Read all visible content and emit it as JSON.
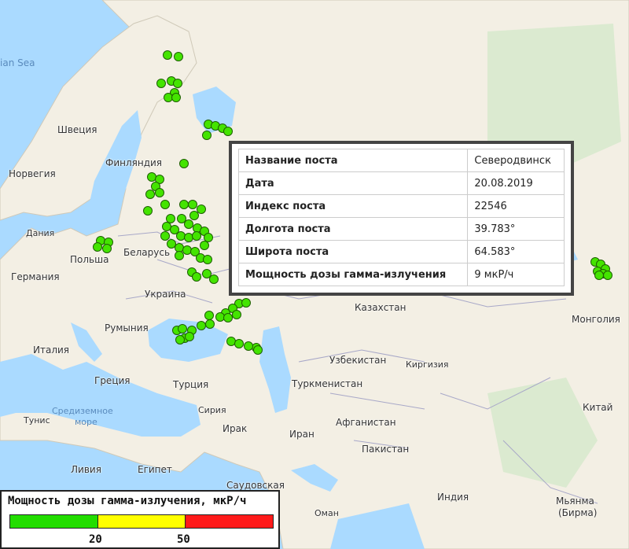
{
  "map": {
    "labels": [
      {
        "text": "ian Sea",
        "type": "sea"
      },
      {
        "text": "Швеция",
        "type": "country"
      },
      {
        "text": "Финляндия",
        "type": "country"
      },
      {
        "text": "Норвегия",
        "type": "country"
      },
      {
        "text": "Дания",
        "type": "country"
      },
      {
        "text": "Беларусь",
        "type": "country"
      },
      {
        "text": "Польша",
        "type": "country"
      },
      {
        "text": "Германия",
        "type": "country"
      },
      {
        "text": "Украина",
        "type": "country"
      },
      {
        "text": "Румыния",
        "type": "country"
      },
      {
        "text": "Италия",
        "type": "country"
      },
      {
        "text": "Греция",
        "type": "country"
      },
      {
        "text": "Турция",
        "type": "country"
      },
      {
        "text": "Средиземное",
        "type": "sea"
      },
      {
        "text": "море",
        "type": "sea"
      },
      {
        "text": "Тунис",
        "type": "country"
      },
      {
        "text": "Сирия",
        "type": "country"
      },
      {
        "text": "Ирак",
        "type": "country"
      },
      {
        "text": "Иран",
        "type": "country"
      },
      {
        "text": "Ливия",
        "type": "country"
      },
      {
        "text": "Египет",
        "type": "country"
      },
      {
        "text": "Саудовская",
        "type": "country"
      },
      {
        "text": "Казахстан",
        "type": "country"
      },
      {
        "text": "Узбекистан",
        "type": "country"
      },
      {
        "text": "Киргизия",
        "type": "country"
      },
      {
        "text": "Туркменистан",
        "type": "country"
      },
      {
        "text": "Афганистан",
        "type": "country"
      },
      {
        "text": "Пакистан",
        "type": "country"
      },
      {
        "text": "Индия",
        "type": "country"
      },
      {
        "text": "Монголия",
        "type": "country"
      },
      {
        "text": "Китай",
        "type": "country"
      },
      {
        "text": "Мьянма",
        "type": "country"
      },
      {
        "text": "(Бирма)",
        "type": "country"
      },
      {
        "text": "Оман",
        "type": "country"
      }
    ],
    "marker_color": "#44e400"
  },
  "popup": {
    "rows": [
      {
        "key": "Название поста",
        "value": "Северодвинск"
      },
      {
        "key": "Дата",
        "value": "20.08.2019"
      },
      {
        "key": "Индекс поста",
        "value": "22546"
      },
      {
        "key": "Долгота поста",
        "value": "39.783°"
      },
      {
        "key": "Широта поста",
        "value": "64.583°"
      },
      {
        "key": "Мощность дозы гамма-излучения",
        "value": "9 мкР/ч"
      }
    ]
  },
  "legend": {
    "title": "Мощность дозы гамма-излучения, мкР/ч",
    "colors": [
      "#22dd00",
      "#ffff00",
      "#ff1a1a"
    ],
    "ticks": [
      "20",
      "50"
    ]
  }
}
